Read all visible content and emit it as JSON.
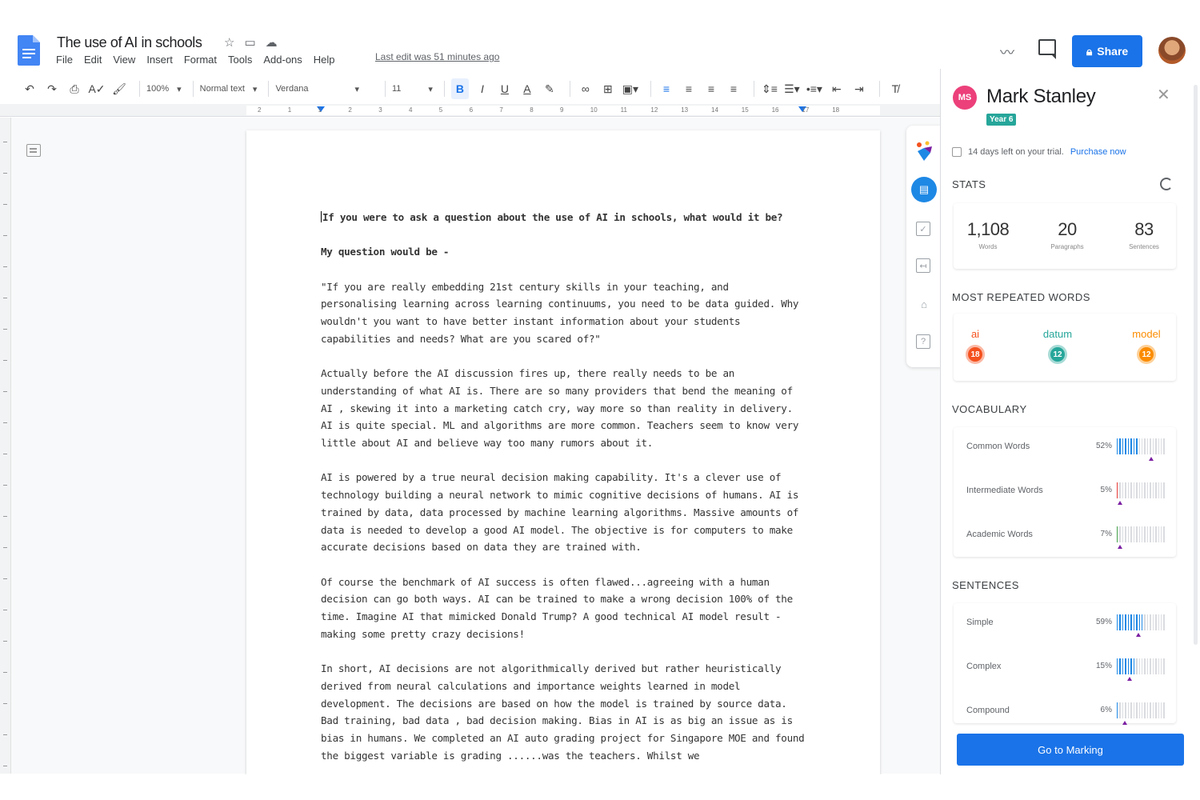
{
  "doc": {
    "title": "The use of AI in schools",
    "menu": [
      "File",
      "Edit",
      "View",
      "Insert",
      "Format",
      "Tools",
      "Add-ons",
      "Help"
    ],
    "last_edit": "Last edit was 51 minutes ago"
  },
  "topright": {
    "share_label": "Share"
  },
  "toolbar": {
    "zoom": "100%",
    "style": "Normal text",
    "font": "Verdana",
    "size": "11"
  },
  "ruler": [
    "2",
    "1",
    "1",
    "2",
    "3",
    "4",
    "5",
    "6",
    "7",
    "8",
    "9",
    "10",
    "11",
    "12",
    "13",
    "14",
    "15",
    "16",
    "17",
    "18"
  ],
  "paragraphs": [
    {
      "bold": true,
      "text": "If you were to ask a question about the use of AI in schools, what would it be?"
    },
    {
      "bold": true,
      "text": "My question would be -"
    },
    {
      "bold": false,
      "text": "\"If you are really embedding 21st century skills in your teaching, and personalising learning across learning continuums, you need to be data guided. Why wouldn't you want to have better instant information about your students capabilities and needs? What are you scared of?\""
    },
    {
      "bold": false,
      "text": "Actually before the AI discussion fires up, there really needs to be an understanding of what AI is. There are so many providers that bend the meaning of AI , skewing it into a marketing catch cry, way more so than reality in delivery. AI is quite special. ML and algorithms are more common. Teachers seem to know very little about AI and believe way too many rumors about it."
    },
    {
      "bold": false,
      "text": "AI is powered by a true neural decision making capability. It's a clever use of technology building a neural network to mimic cognitive decisions of humans.  AI is trained by data, data processed by machine learning algorithms. Massive amounts of data is needed to develop a good AI model. The objective is for computers to make accurate decisions based on data they are trained with."
    },
    {
      "bold": false,
      "text": "Of course the benchmark of AI success is often flawed...agreeing with a human decision can go both ways. AI can be trained to make a wrong decision 100% of the time. Imagine AI that mimicked  Donald Trump? A good technical AI model result - making some pretty crazy decisions!"
    },
    {
      "bold": false,
      "text": "In short, AI decisions are not algorithmically derived but rather heuristically derived from neural calculations and importance weights learned in model development. The decisions are based on how the model is trained by source data. Bad training, bad data , bad decision making. Bias in AI is as big an issue as is bias in humans. We completed an AI auto grading project for Singapore MOE and found the biggest variable is grading ......was the teachers. Whilst we"
    }
  ],
  "panel": {
    "initials": "MS",
    "user_name": "Mark Stanley",
    "year": "Year 6",
    "trial_text": "14 days left on your trial.",
    "trial_link": "Purchase now",
    "stats_head": "STATS",
    "stats": [
      {
        "value": "1,108",
        "label": "Words"
      },
      {
        "value": "20",
        "label": "Paragraphs"
      },
      {
        "value": "83",
        "label": "Sentences"
      }
    ],
    "repeated_head": "MOST REPEATED WORDS",
    "repeated": [
      {
        "word": "ai",
        "count": "18",
        "color": "#f4511e"
      },
      {
        "word": "datum",
        "count": "12",
        "color": "#26a69a"
      },
      {
        "word": "model",
        "count": "12",
        "color": "#fb8c00"
      }
    ],
    "vocab_head": "VOCABULARY",
    "vocab": [
      {
        "label": "Common Words",
        "pct": "52%",
        "fill": 0.52,
        "color": "#1e88e5",
        "marker": 0.72
      },
      {
        "label": "Intermediate Words",
        "pct": "5%",
        "fill": 0.05,
        "color": "#e53935",
        "marker": 0.06
      },
      {
        "label": "Academic Words",
        "pct": "7%",
        "fill": 0.07,
        "color": "#43a047",
        "marker": 0.06
      }
    ],
    "sentences_head": "SENTENCES",
    "sentences": [
      {
        "label": "Simple",
        "pct": "59%",
        "fill": 0.59,
        "color": "#1e88e5",
        "marker": 0.45
      },
      {
        "label": "Complex",
        "pct": "15%",
        "fill": 0.45,
        "color": "#1e88e5",
        "marker": 0.26
      },
      {
        "label": "Compound",
        "pct": "6%",
        "fill": 0.06,
        "color": "#1e88e5",
        "marker": 0.16
      }
    ],
    "go_button": "Go to Marking"
  }
}
